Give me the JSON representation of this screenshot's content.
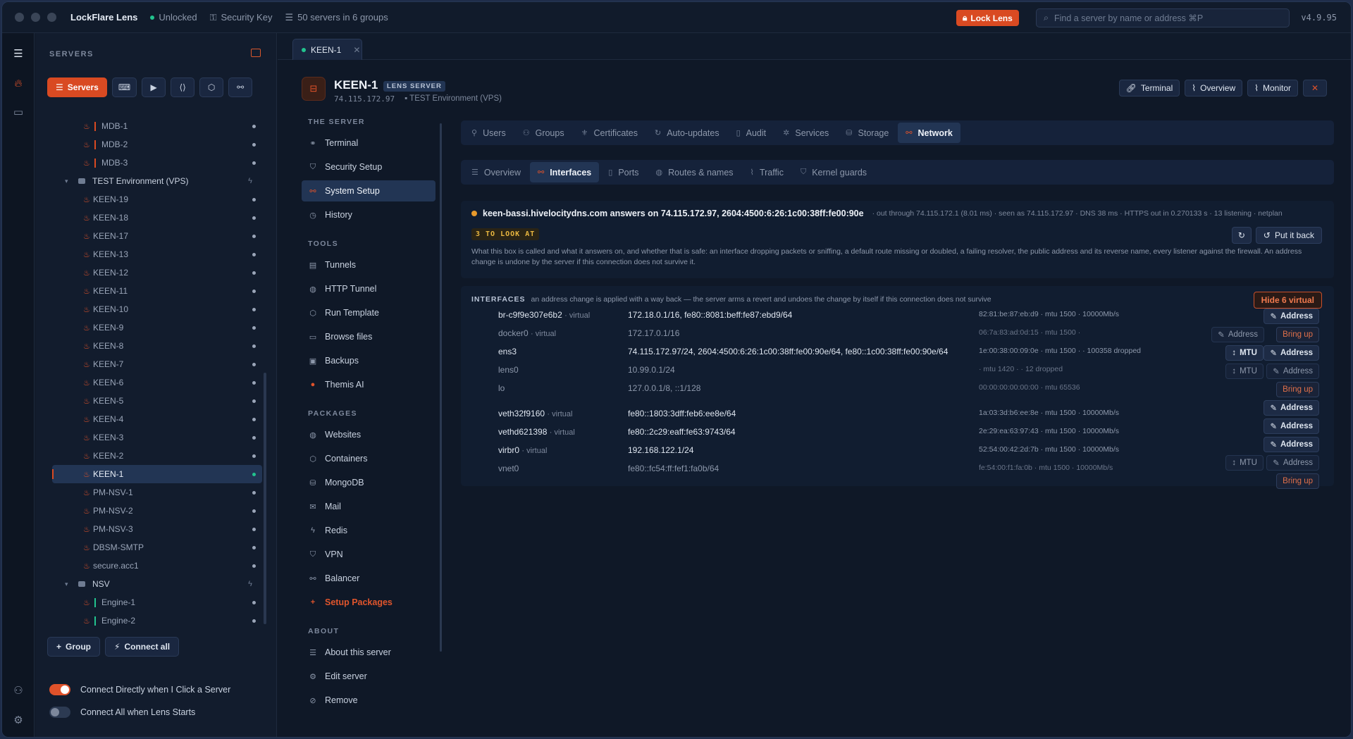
{
  "titlebar": {
    "brand": "LockFlare Lens",
    "status": "Unlocked",
    "key": "Security Key",
    "servers_count": "50 servers in 6 groups",
    "lock_label": "Lock Lens",
    "search_placeholder": "Find a server by name or address ⌘P",
    "version": "v4.9.95"
  },
  "sidebar": {
    "title": "SERVERS",
    "servers_button": "Servers",
    "group_button": "Group",
    "connect_all_button": "Connect all",
    "toggle_connect_directly": "Connect Directly when I Click a Server",
    "toggle_connect_on_start": "Connect All when Lens Starts",
    "tree": [
      {
        "type": "server",
        "name": "MDB-1",
        "bar": "red"
      },
      {
        "type": "server",
        "name": "MDB-2",
        "bar": "red"
      },
      {
        "type": "server",
        "name": "MDB-3",
        "bar": "red"
      },
      {
        "type": "group",
        "name": "TEST Environment (VPS)"
      },
      {
        "type": "server",
        "name": "KEEN-19"
      },
      {
        "type": "server",
        "name": "KEEN-18"
      },
      {
        "type": "server",
        "name": "KEEN-17"
      },
      {
        "type": "server",
        "name": "KEEN-13"
      },
      {
        "type": "server",
        "name": "KEEN-12"
      },
      {
        "type": "server",
        "name": "KEEN-11"
      },
      {
        "type": "server",
        "name": "KEEN-10"
      },
      {
        "type": "server",
        "name": "KEEN-9"
      },
      {
        "type": "server",
        "name": "KEEN-8"
      },
      {
        "type": "server",
        "name": "KEEN-7"
      },
      {
        "type": "server",
        "name": "KEEN-6"
      },
      {
        "type": "server",
        "name": "KEEN-5"
      },
      {
        "type": "server",
        "name": "KEEN-4"
      },
      {
        "type": "server",
        "name": "KEEN-3"
      },
      {
        "type": "server",
        "name": "KEEN-2"
      },
      {
        "type": "server",
        "name": "KEEN-1",
        "selected": true
      },
      {
        "type": "server",
        "name": "PM-NSV-1"
      },
      {
        "type": "server",
        "name": "PM-NSV-2"
      },
      {
        "type": "server",
        "name": "PM-NSV-3"
      },
      {
        "type": "server",
        "name": "DBSM-SMTP"
      },
      {
        "type": "server",
        "name": "secure.acc1"
      },
      {
        "type": "group",
        "name": "NSV"
      },
      {
        "type": "server",
        "name": "Engine-1",
        "bar": "green"
      },
      {
        "type": "server",
        "name": "Engine-2",
        "bar": "green"
      }
    ]
  },
  "main": {
    "tab_label": "KEEN-1",
    "server": {
      "name": "KEEN-1",
      "badge": "LENS SERVER",
      "ip": "74.115.172.97",
      "group": "TEST Environment (VPS)"
    },
    "actions": {
      "terminal": "Terminal",
      "overview": "Overview",
      "monitor": "Monitor"
    },
    "subnav": {
      "the_server": "THE SERVER",
      "terminal": "Terminal",
      "security_setup": "Security Setup",
      "system_setup": "System Setup",
      "history": "History",
      "tools": "TOOLS",
      "tunnels": "Tunnels",
      "http_tunnel": "HTTP Tunnel",
      "run_template": "Run Template",
      "browse_files": "Browse files",
      "backups": "Backups",
      "themis_ai": "Themis AI",
      "packages": "PACKAGES",
      "websites": "Websites",
      "containers": "Containers",
      "mongodb": "MongoDB",
      "mail": "Mail",
      "redis": "Redis",
      "vpn": "VPN",
      "balancer": "Balancer",
      "setup_packages": "Setup Packages",
      "about": "ABOUT",
      "about_server": "About this server",
      "edit_server": "Edit server",
      "remove": "Remove"
    },
    "top_tabs": {
      "users": "Users",
      "groups": "Groups",
      "certificates": "Certificates",
      "auto_updates": "Auto-updates",
      "audit": "Audit",
      "services": "Services",
      "storage": "Storage",
      "network": "Network"
    },
    "net_tabs": {
      "overview": "Overview",
      "interfaces": "Interfaces",
      "ports": "Ports",
      "routes": "Routes & names",
      "traffic": "Traffic",
      "kernel": "Kernel guards"
    },
    "status": {
      "host": "keen-bassi.hivelocitydns.com answers on 74.115.172.97, 2604:4500:6:26:1c00:38ff:fe00:90e",
      "meta": "· out through 74.115.172.1 (8.01 ms) · seen as 74.115.172.97 · DNS 38 ms · HTTPS out in 0.270133 s · 13 listening · netplan",
      "badge": "3 TO LOOK AT",
      "put_back": "Put it back",
      "description": "What this box is called and what it answers on, and whether that is safe: an interface dropping packets or sniffing, a default route missing or doubled, a failing resolver, the public address and its reverse name, every listener against the firewall. An address change is undone by the server if this connection does not survive it."
    },
    "interfaces": {
      "title": "INTERFACES",
      "note": "an address change is applied with a way back — the server arms a revert and undoes the change by itself if this connection does not survive",
      "hide_label": "Hide 6 virtual",
      "address_label": "Address",
      "mtu_label": "MTU",
      "bring_up_label": "Bring up",
      "rows": [
        {
          "name": "br-c9f9e307e6b2",
          "virtual": "· virtual",
          "addr": "172.18.0.1/16, fe80::8081:beff:fe87:ebd9/64",
          "hw": "82:81:be:87:eb:d9 · mtu 1500 · 10000Mb/s"
        },
        {
          "name": "docker0",
          "virtual": "· virtual",
          "addr": "172.17.0.1/16",
          "hw": "06:7a:83:ad:0d:15 · mtu 1500 ·"
        },
        {
          "name": "ens3",
          "virtual": "",
          "addr": "74.115.172.97/24, 2604:4500:6:26:1c00:38ff:fe00:90e/64, fe80::1c00:38ff:fe00:90e/64",
          "hw": "1e:00:38:00:09:0e · mtu 1500 · · 100358 dropped"
        },
        {
          "name": "lens0",
          "virtual": "",
          "addr": "10.99.0.1/24",
          "hw": "· mtu 1420 · · 12 dropped"
        },
        {
          "name": "lo",
          "virtual": "",
          "addr": "127.0.0.1/8, ::1/128",
          "hw": "00:00:00:00:00:00 · mtu 65536"
        },
        {
          "name": "veth32f9160",
          "virtual": "· virtual",
          "addr": "fe80::1803:3dff:feb6:ee8e/64",
          "hw": "1a:03:3d:b6:ee:8e · mtu 1500 · 10000Mb/s"
        },
        {
          "name": "vethd621398",
          "virtual": "· virtual",
          "addr": "fe80::2c29:eaff:fe63:9743/64",
          "hw": "2e:29:ea:63:97:43 · mtu 1500 · 10000Mb/s"
        },
        {
          "name": "virbr0",
          "virtual": "· virtual",
          "addr": "192.168.122.1/24",
          "hw": "52:54:00:42:2d:7b · mtu 1500 · 10000Mb/s"
        },
        {
          "name": "vnet0",
          "virtual": "",
          "addr": "fe80::fc54:ff:fef1:fa0b/64",
          "hw": "fe:54:00:f1:fa:0b · mtu 1500 · 10000Mb/s"
        }
      ]
    }
  },
  "colors": {
    "accent": "#d94a22",
    "online": "#22c38e",
    "warning": "#e89a2c"
  }
}
